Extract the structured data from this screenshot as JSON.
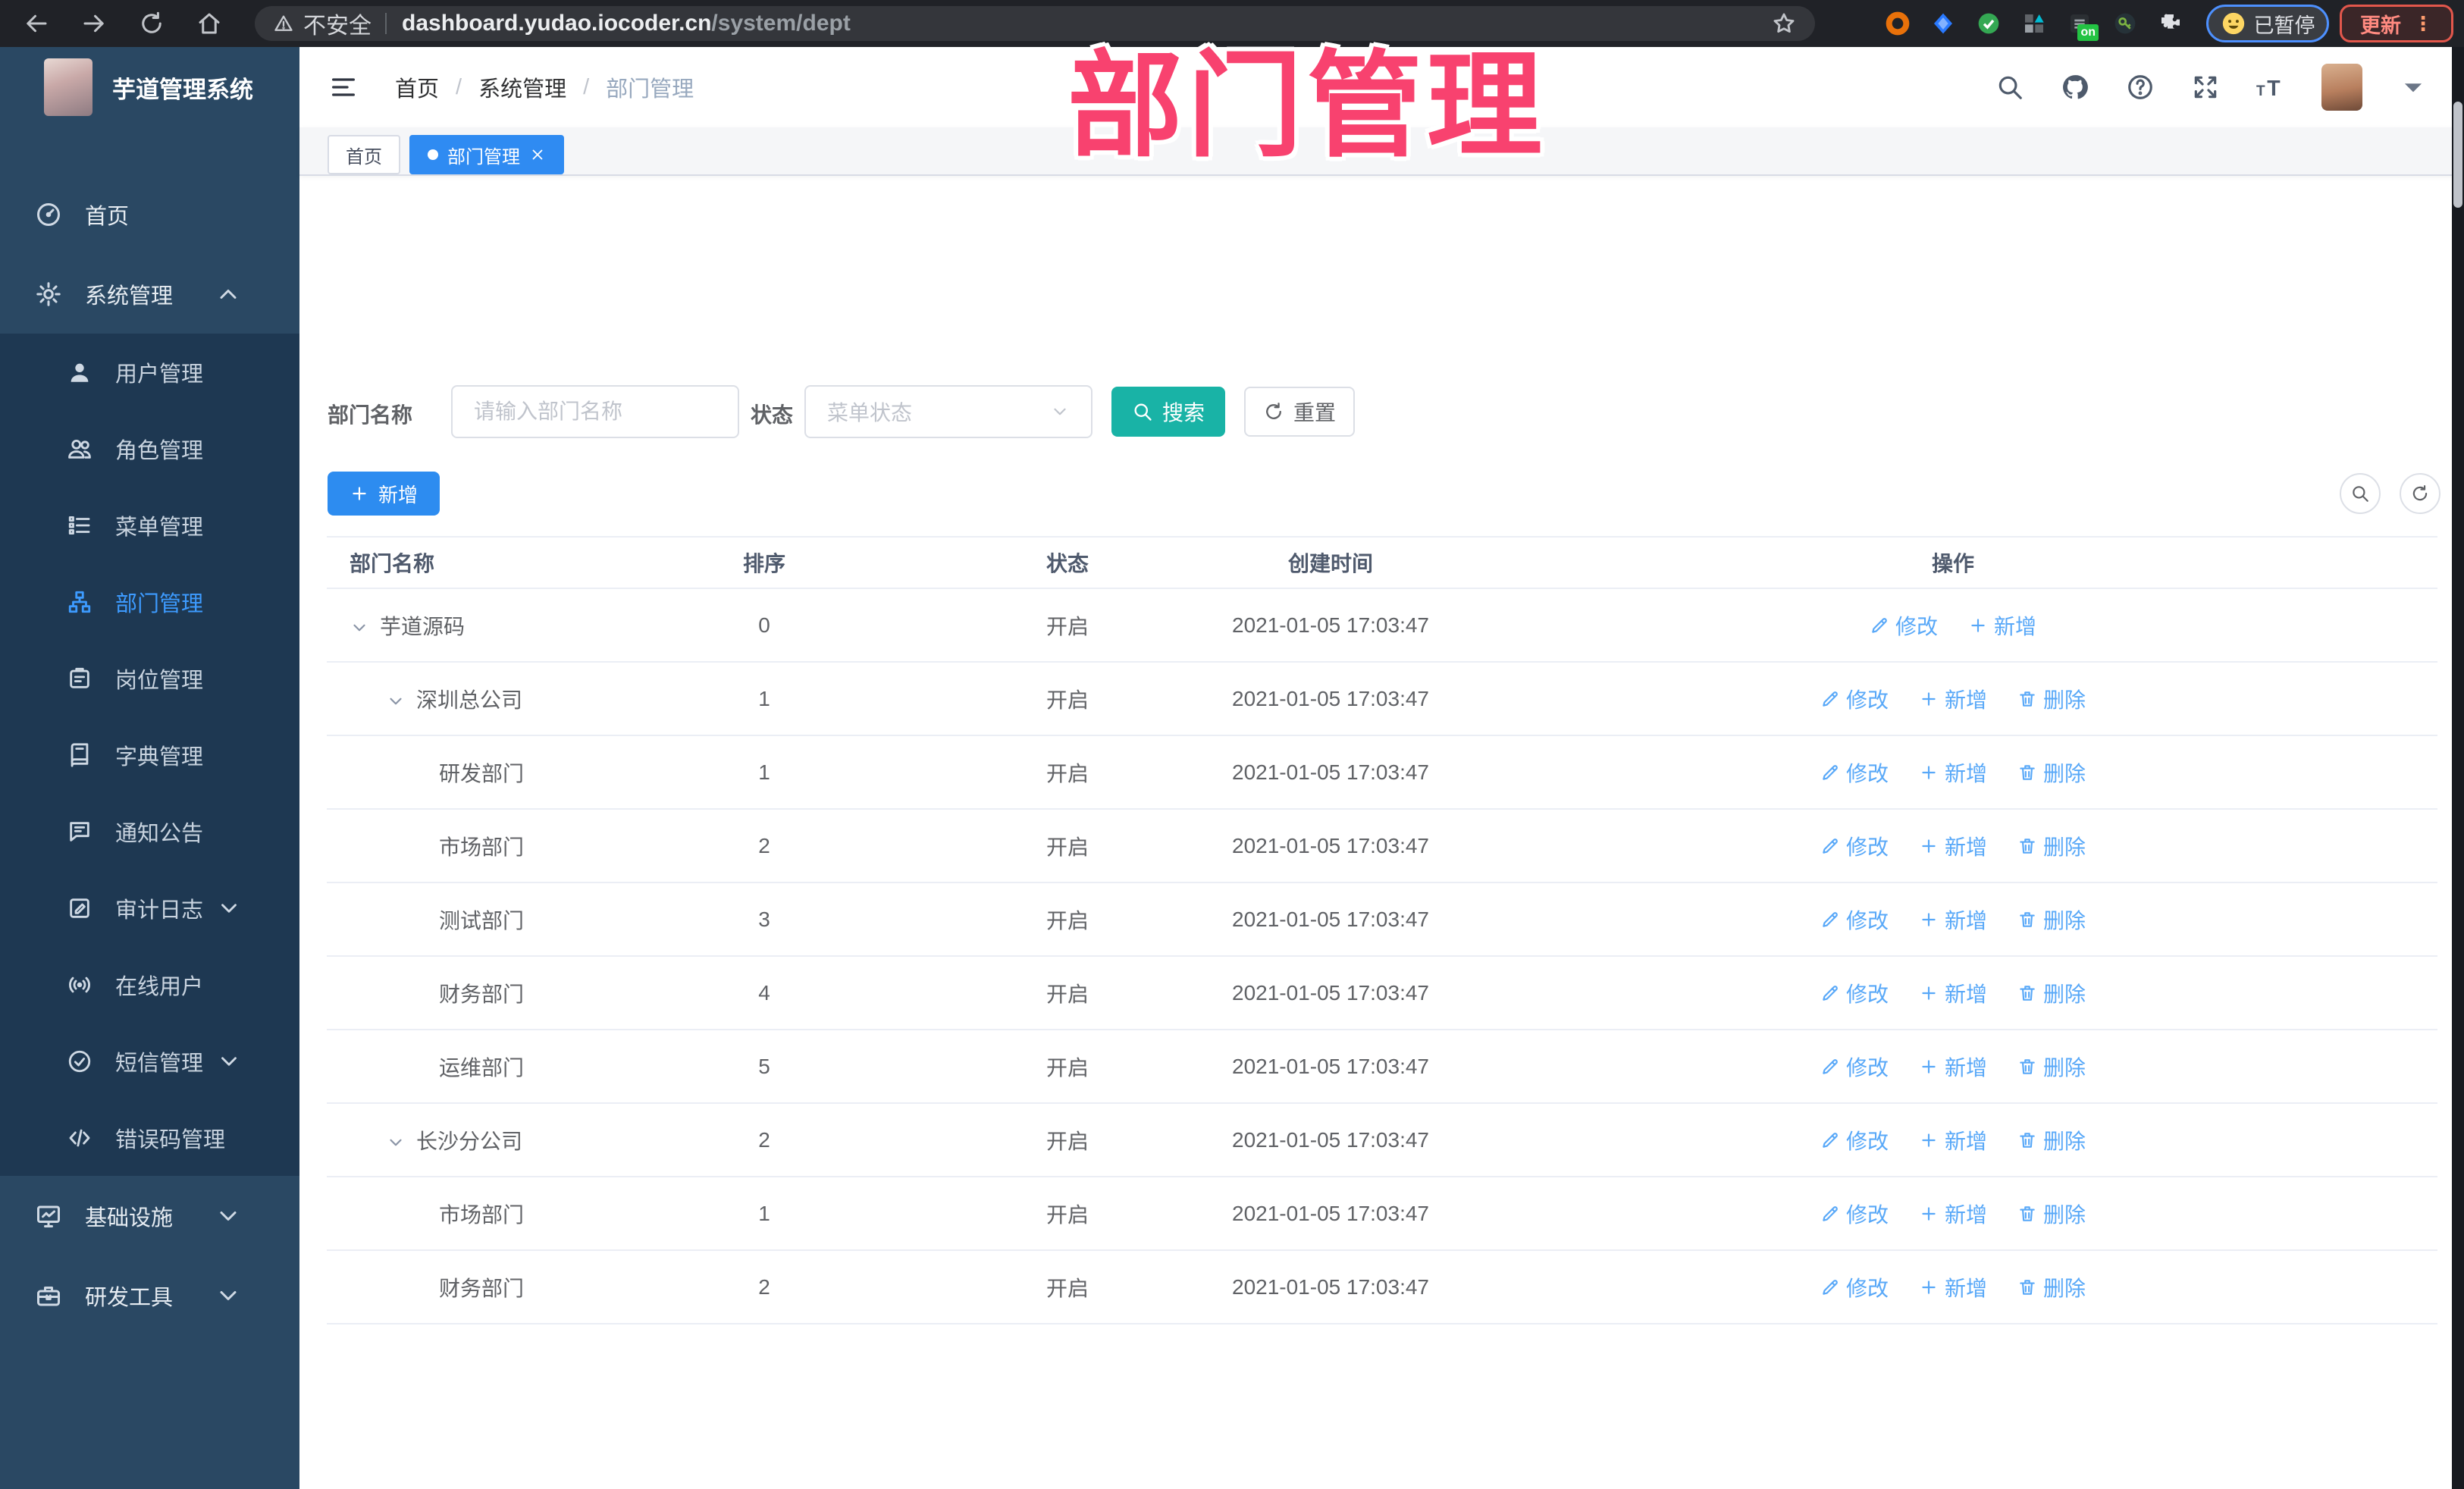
{
  "colors": {
    "primary": "#2D8CF0",
    "tab_active": "#2F8BF2",
    "teal": "#19B3A6",
    "link": "#58A8F8",
    "watermark": "#F8426F",
    "sidebar_bg": "#2A4863",
    "submenu_bg": "#1E3852",
    "active_menu": "#3D9BFF"
  },
  "watermark": "部门管理",
  "browser": {
    "security_label": "不安全",
    "url_host": "dashboard.yudao.iocoder.cn",
    "url_path": "/system/dept",
    "ext_badge": "on",
    "profile_label": "已暂停",
    "update_label": "更新",
    "nav_icons": [
      "back-arrow-icon",
      "forward-arrow-icon",
      "reload-icon",
      "home-icon"
    ],
    "extensions": [
      {
        "icon": "ext-orange-ring-icon"
      },
      {
        "icon": "ext-blue-gem-icon"
      },
      {
        "icon": "ext-green-check-icon"
      },
      {
        "icon": "ext-grid-icon"
      },
      {
        "icon": "ext-tag-on-icon",
        "badge": true
      },
      {
        "icon": "ext-key-icon"
      },
      {
        "icon": "ext-puzzle-icon"
      }
    ]
  },
  "sidebar": {
    "title": "芋道管理系统",
    "items": [
      {
        "label": "首页",
        "icon": "dashboard-icon",
        "type": "top"
      },
      {
        "label": "系统管理",
        "icon": "gear-icon",
        "type": "top",
        "chevron": "up"
      },
      {
        "label": "用户管理",
        "icon": "user-icon",
        "type": "sub"
      },
      {
        "label": "角色管理",
        "icon": "users-icon",
        "type": "sub"
      },
      {
        "label": "菜单管理",
        "icon": "menu-list-icon",
        "type": "sub"
      },
      {
        "label": "部门管理",
        "icon": "org-tree-icon",
        "type": "sub",
        "active": true
      },
      {
        "label": "岗位管理",
        "icon": "badge-icon",
        "type": "sub"
      },
      {
        "label": "字典管理",
        "icon": "book-icon",
        "type": "sub"
      },
      {
        "label": "通知公告",
        "icon": "megaphone-icon",
        "type": "sub"
      },
      {
        "label": "审计日志",
        "icon": "log-icon",
        "type": "sub",
        "chevron": "down"
      },
      {
        "label": "在线用户",
        "icon": "signal-icon",
        "type": "sub"
      },
      {
        "label": "短信管理",
        "icon": "sms-icon",
        "type": "sub",
        "chevron": "down"
      },
      {
        "label": "错误码管理",
        "icon": "code-icon",
        "type": "sub"
      },
      {
        "label": "基础设施",
        "icon": "monitor-icon",
        "type": "top",
        "chevron": "down"
      },
      {
        "label": "研发工具",
        "icon": "toolbox-icon",
        "type": "top",
        "chevron": "down"
      }
    ]
  },
  "header": {
    "breadcrumb": [
      "首页",
      "系统管理",
      "部门管理"
    ],
    "breadcrumb_sep": "/",
    "icons": [
      "search-icon",
      "github-icon",
      "help-icon",
      "fullscreen-icon",
      "fontsize-icon"
    ]
  },
  "tabs": [
    {
      "label": "首页"
    },
    {
      "label": "部门管理",
      "active": true,
      "closable": true
    }
  ],
  "filters": {
    "name_label": "部门名称",
    "name_placeholder": "请输入部门名称",
    "status_label": "状态",
    "status_placeholder": "菜单状态",
    "search_label": "搜索",
    "reset_label": "重置"
  },
  "toolbar": {
    "add_label": "新增"
  },
  "table": {
    "headers": [
      "部门名称",
      "排序",
      "状态",
      "创建时间",
      "操作"
    ],
    "action_labels": {
      "modify": "修改",
      "add": "新增",
      "delete": "删除"
    },
    "rows": [
      {
        "name": "芋道源码",
        "level": 0,
        "expand": true,
        "sort": "0",
        "status": "开启",
        "time": "2021-01-05 17:03:47",
        "actions": [
          "modify",
          "add"
        ]
      },
      {
        "name": "深圳总公司",
        "level": 1,
        "expand": true,
        "sort": "1",
        "status": "开启",
        "time": "2021-01-05 17:03:47",
        "actions": [
          "modify",
          "add",
          "delete"
        ]
      },
      {
        "name": "研发部门",
        "level": 2,
        "expand": false,
        "sort": "1",
        "status": "开启",
        "time": "2021-01-05 17:03:47",
        "actions": [
          "modify",
          "add",
          "delete"
        ]
      },
      {
        "name": "市场部门",
        "level": 2,
        "expand": false,
        "sort": "2",
        "status": "开启",
        "time": "2021-01-05 17:03:47",
        "actions": [
          "modify",
          "add",
          "delete"
        ]
      },
      {
        "name": "测试部门",
        "level": 2,
        "expand": false,
        "sort": "3",
        "status": "开启",
        "time": "2021-01-05 17:03:47",
        "actions": [
          "modify",
          "add",
          "delete"
        ]
      },
      {
        "name": "财务部门",
        "level": 2,
        "expand": false,
        "sort": "4",
        "status": "开启",
        "time": "2021-01-05 17:03:47",
        "actions": [
          "modify",
          "add",
          "delete"
        ]
      },
      {
        "name": "运维部门",
        "level": 2,
        "expand": false,
        "sort": "5",
        "status": "开启",
        "time": "2021-01-05 17:03:47",
        "actions": [
          "modify",
          "add",
          "delete"
        ]
      },
      {
        "name": "长沙分公司",
        "level": 1,
        "expand": true,
        "sort": "2",
        "status": "开启",
        "time": "2021-01-05 17:03:47",
        "actions": [
          "modify",
          "add",
          "delete"
        ]
      },
      {
        "name": "市场部门",
        "level": 2,
        "expand": false,
        "sort": "1",
        "status": "开启",
        "time": "2021-01-05 17:03:47",
        "actions": [
          "modify",
          "add",
          "delete"
        ]
      },
      {
        "name": "财务部门",
        "level": 2,
        "expand": false,
        "sort": "2",
        "status": "开启",
        "time": "2021-01-05 17:03:47",
        "actions": [
          "modify",
          "add",
          "delete"
        ]
      }
    ]
  }
}
